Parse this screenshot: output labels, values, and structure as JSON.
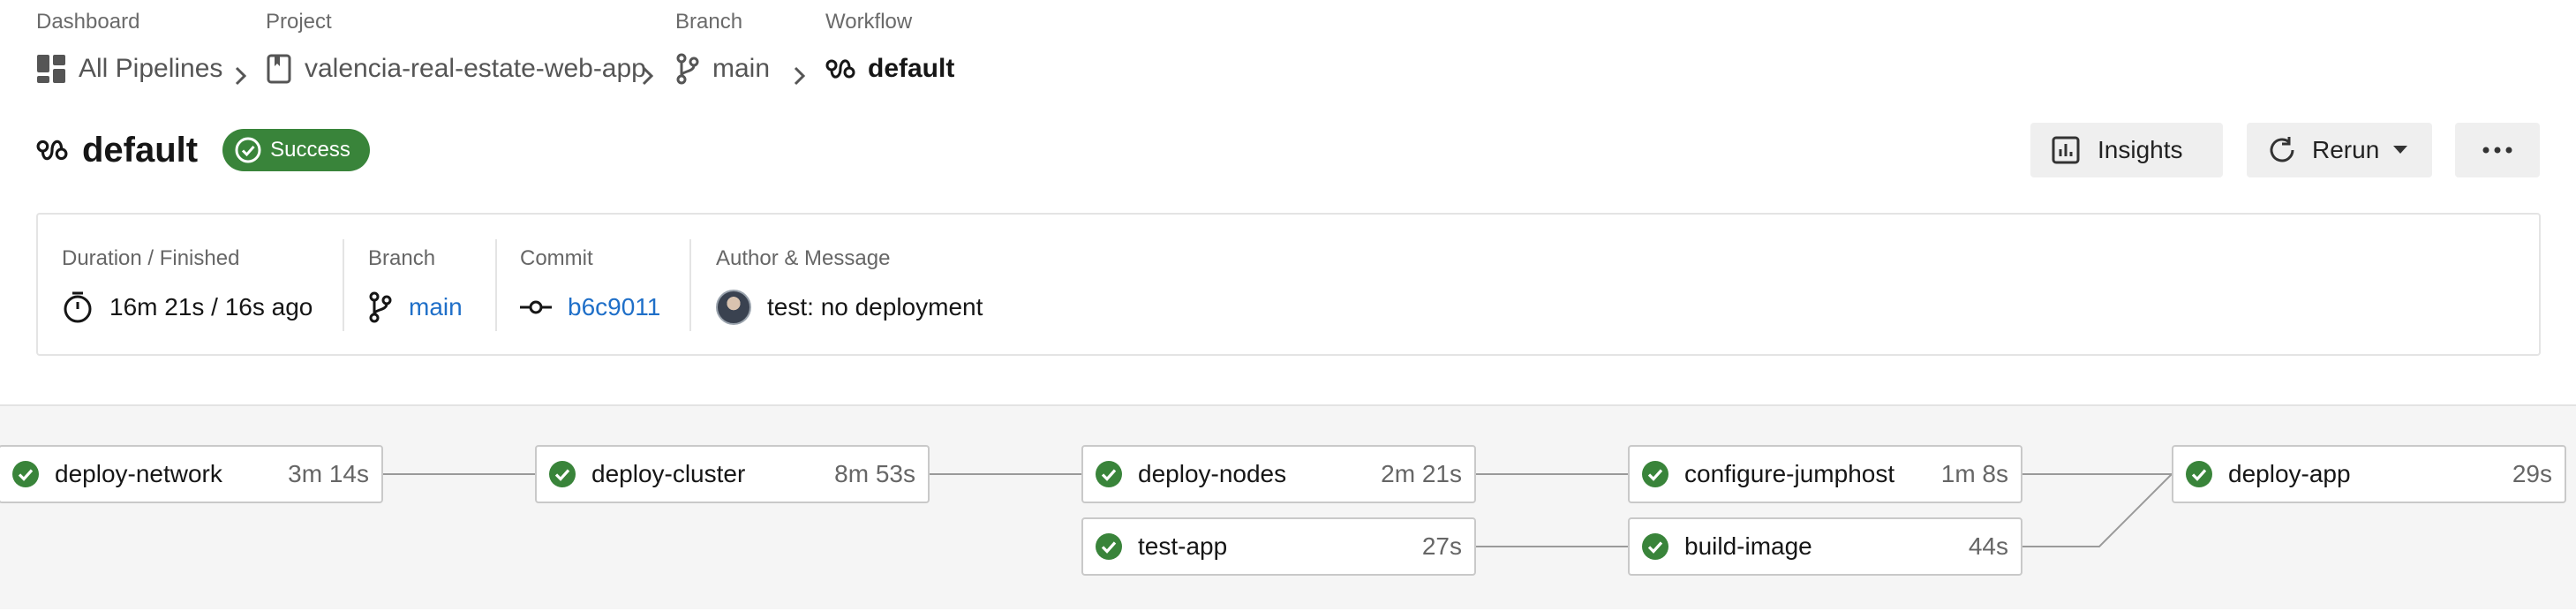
{
  "breadcrumb": {
    "dashboard": {
      "label": "Dashboard",
      "value": "All Pipelines"
    },
    "project": {
      "label": "Project",
      "value": "valencia-real-estate-web-app"
    },
    "branch": {
      "label": "Branch",
      "value": "main"
    },
    "workflow": {
      "label": "Workflow",
      "value": "default"
    }
  },
  "header": {
    "title": "default",
    "status": "Success",
    "insights_label": "Insights",
    "rerun_label": "Rerun"
  },
  "summary": {
    "duration": {
      "label": "Duration / Finished",
      "value": "16m 21s / 16s ago"
    },
    "branch": {
      "label": "Branch",
      "value": "main"
    },
    "commit": {
      "label": "Commit",
      "value": "b6c9011"
    },
    "author": {
      "label": "Author & Message",
      "value": "test: no deployment"
    }
  },
  "jobs": [
    {
      "name": "deploy-network",
      "duration": "3m 14s",
      "status": "success"
    },
    {
      "name": "deploy-cluster",
      "duration": "8m 53s",
      "status": "success"
    },
    {
      "name": "deploy-nodes",
      "duration": "2m 21s",
      "status": "success"
    },
    {
      "name": "test-app",
      "duration": "27s",
      "status": "success"
    },
    {
      "name": "configure-jumphost",
      "duration": "1m 8s",
      "status": "success"
    },
    {
      "name": "build-image",
      "duration": "44s",
      "status": "success"
    },
    {
      "name": "deploy-app",
      "duration": "29s",
      "status": "success"
    }
  ],
  "colors": {
    "success": "#39843a",
    "link": "#1f6fc8",
    "button_bg": "#efefef"
  },
  "icons": {
    "dashboard": "dashboard-grid-icon",
    "project": "repository-icon",
    "branch": "branch-icon",
    "workflow": "workflow-icon",
    "insights": "bar-chart-icon",
    "rerun": "refresh-icon",
    "more": "ellipsis-icon",
    "duration": "timer-icon",
    "commit": "commit-icon"
  }
}
